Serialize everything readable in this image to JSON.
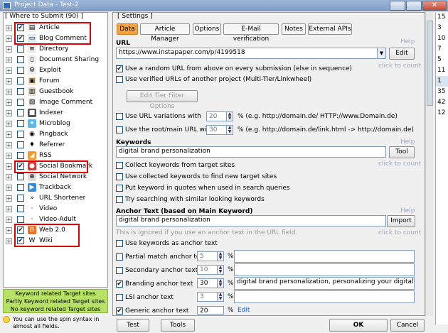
{
  "window": {
    "title": "Project Data - Test-2"
  },
  "left_panel": {
    "header": "[ Where to Submit  (90) ]",
    "items": [
      {
        "label": "Article",
        "checked": true,
        "icon": "article-icon"
      },
      {
        "label": "Blog Comment",
        "checked": true,
        "icon": "blog-comment-icon"
      },
      {
        "label": "Directory",
        "checked": false,
        "icon": "directory-icon"
      },
      {
        "label": "Document Sharing",
        "checked": false,
        "icon": "document-sharing-icon"
      },
      {
        "label": "Exploit",
        "checked": false,
        "icon": "exploit-icon"
      },
      {
        "label": "Forum",
        "checked": false,
        "icon": "forum-icon"
      },
      {
        "label": "Guestbook",
        "checked": false,
        "icon": "guestbook-icon"
      },
      {
        "label": "Image Comment",
        "checked": false,
        "icon": "image-comment-icon"
      },
      {
        "label": "Indexer",
        "checked": false,
        "icon": "indexer-icon"
      },
      {
        "label": "Microblog",
        "checked": false,
        "icon": "microblog-icon"
      },
      {
        "label": "Pingback",
        "checked": false,
        "icon": "pingback-icon"
      },
      {
        "label": "Referrer",
        "checked": false,
        "icon": "referrer-icon"
      },
      {
        "label": "RSS",
        "checked": false,
        "icon": "rss-icon"
      },
      {
        "label": "Social Bookmark",
        "checked": true,
        "icon": "social-bookmark-icon"
      },
      {
        "label": "Social Network",
        "checked": false,
        "icon": "social-network-icon"
      },
      {
        "label": "Trackback",
        "checked": false,
        "icon": "trackback-icon"
      },
      {
        "label": "URL Shortener",
        "checked": false,
        "icon": "url-shortener-icon"
      },
      {
        "label": "Video",
        "checked": false,
        "icon": "video-icon"
      },
      {
        "label": "Video-Adult",
        "checked": false,
        "icon": "video-adult-icon"
      },
      {
        "label": "Web 2.0",
        "checked": true,
        "icon": "web20-icon"
      },
      {
        "label": "Wiki",
        "checked": true,
        "icon": "wiki-icon"
      }
    ],
    "legend": [
      "Keyword related Target sites",
      "Partly Keyword related Target sites",
      "No keyword related Target sites"
    ],
    "info": "You can use the spin syntax in almost all fields."
  },
  "settings": {
    "header": "[ Settings ]",
    "tabs": [
      "Data",
      "Article Manager",
      "Options",
      "E-Mail verification",
      "Notes",
      "External APIs"
    ],
    "url": {
      "label": "URL",
      "help": "Help",
      "value": "https://www.instapaper.com/p/4199518",
      "edit": "Edit",
      "click_to_count": "click to count",
      "random_label": "Use a random URL from above on every submission (else in sequence)",
      "verified_label": "Use verified URLs of another project (Multi-Tier/Linkwheel)",
      "tier_button": "Edit Tier Filter Options",
      "variations_label": "Use URL variations with",
      "variations_value": "20",
      "variations_suffix": "% (e.g. http://domain.de/ HTTP://www.Domain.de)",
      "root_label": "Use the root/main URL with",
      "root_value": "30",
      "root_suffix": "% (e.g. http://domain.de/link.html -> http://domain.de)"
    },
    "keywords": {
      "label": "Keywords",
      "help": "Help",
      "value": "digital brand personalization",
      "tool": "Tool",
      "click_to_count": "click to count",
      "opt1": "Collect keywords from target sites",
      "opt2": "Use collected keywords to find new target sites",
      "opt3": "Put keyword in quotes when used in search queries",
      "opt4": "Try searching with similar looking keywords"
    },
    "anchor": {
      "label": "Anchor Text (based on Main Keyword)",
      "help": "Help",
      "value": "digital brand personalization",
      "import": "Import",
      "note": "This is ignored if you use an anchor text in the URL field.",
      "click_to_count": "click to count",
      "use_keywords": "Use keywords as anchor text",
      "partial": "Partial match anchor text",
      "partial_value": "5",
      "secondary": "Secondary anchor text",
      "secondary_value": "10",
      "branding": "Branding anchor text",
      "branding_value": "30",
      "branding_text": "digital brand personalization, personalizing your digital brand",
      "lsi": "LSI anchor text",
      "lsi_value": "3",
      "generic": "Generic anchor text",
      "generic_value": "20",
      "edit": "Edit",
      "percent": "%"
    }
  },
  "buttons": {
    "test": "Test",
    "tools": "Tools",
    "ok": "OK",
    "cancel": "Cancel"
  },
  "right_column": [
    "15",
    "3",
    "10",
    "7",
    "5",
    "11",
    "1",
    "35",
    "42",
    "12",
    "",
    "",
    "",
    "",
    "",
    "",
    "",
    "",
    "",
    "",
    "",
    "",
    "",
    "",
    "",
    "",
    "",
    "",
    ""
  ]
}
